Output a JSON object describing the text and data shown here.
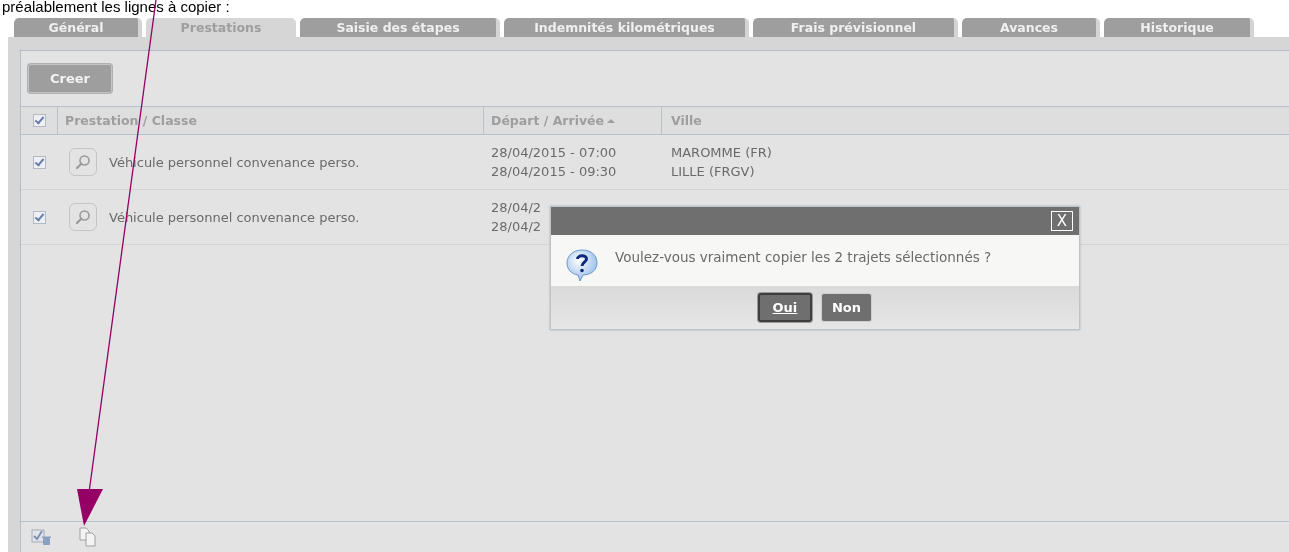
{
  "caption": "préalablement les lignes à copier :",
  "tabs": [
    {
      "label": "Général",
      "selected": false
    },
    {
      "label": "Prestations",
      "selected": true
    },
    {
      "label": "Saisie des étapes",
      "selected": false
    },
    {
      "label": "Indemnités kilométriques",
      "selected": false
    },
    {
      "label": "Frais prévisionnel",
      "selected": false
    },
    {
      "label": "Avances",
      "selected": false
    },
    {
      "label": "Historique",
      "selected": false
    }
  ],
  "create_button": "Creer",
  "table": {
    "header_checked": true,
    "columns": [
      "Prestation / Classe",
      "Départ / Arrivée",
      "Ville"
    ],
    "rows": [
      {
        "checked": true,
        "prestation": "Véhicule personnel convenance perso.",
        "dates": [
          "28/04/2015 - 07:00",
          "28/04/2015 - 09:30"
        ],
        "cities": [
          "MAROMME (FR)",
          "LILLE (FRGV)"
        ]
      },
      {
        "checked": true,
        "prestation": "Véhicule personnel convenance perso.",
        "dates": [
          "28/04/2",
          "28/04/2"
        ],
        "cities": []
      }
    ]
  },
  "dialog": {
    "close": "X",
    "message": "Voulez-vous vraiment copier les 2 trajets sélectionnés ?",
    "buttons": [
      {
        "label": "Oui",
        "selected": true
      },
      {
        "label": "Non",
        "selected": false
      }
    ]
  }
}
